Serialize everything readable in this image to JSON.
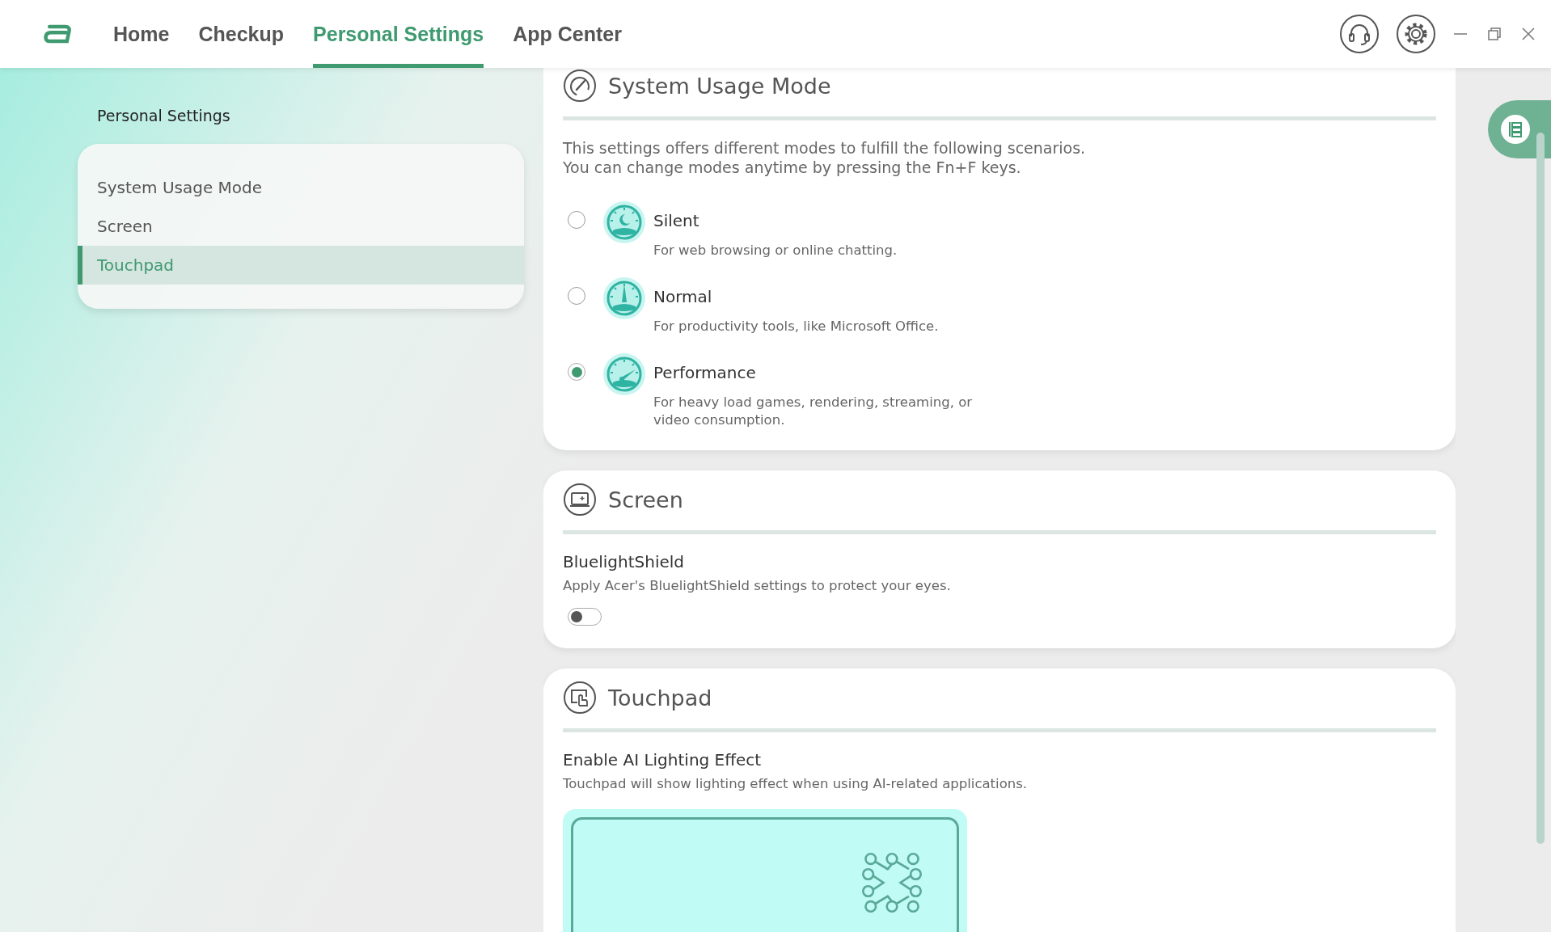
{
  "nav": {
    "tabs": [
      {
        "label": "Home",
        "selected": false
      },
      {
        "label": "Checkup",
        "selected": false
      },
      {
        "label": "Personal Settings",
        "selected": true
      },
      {
        "label": "App Center",
        "selected": false
      }
    ]
  },
  "sidebar": {
    "title": "Personal Settings",
    "items": [
      {
        "label": "System Usage Mode",
        "selected": false
      },
      {
        "label": "Screen",
        "selected": false
      },
      {
        "label": "Touchpad",
        "selected": true
      }
    ]
  },
  "system_usage_mode": {
    "title": "System Usage Mode",
    "description": [
      "This settings offers different modes to fulfill the following scenarios.",
      "You can change modes anytime by pressing the Fn+F keys."
    ],
    "modes": [
      {
        "label": "Silent",
        "description": "For web browsing or online chatting.",
        "selected": false
      },
      {
        "label": "Normal",
        "description": "For productivity tools, like Microsoft Office.",
        "selected": false
      },
      {
        "label": "Performance",
        "description": "For heavy load games, rendering, streaming, or video consumption.",
        "selected": true
      }
    ]
  },
  "screen": {
    "title": "Screen",
    "setting": {
      "label": "BluelightShield",
      "description": "Apply Acer's BluelightShield settings to protect your eyes.",
      "on": false
    }
  },
  "touchpad": {
    "title": "Touchpad",
    "setting": {
      "label": "Enable AI Lighting Effect",
      "description": "Touchpad will show lighting effect when using AI-related applications."
    }
  }
}
